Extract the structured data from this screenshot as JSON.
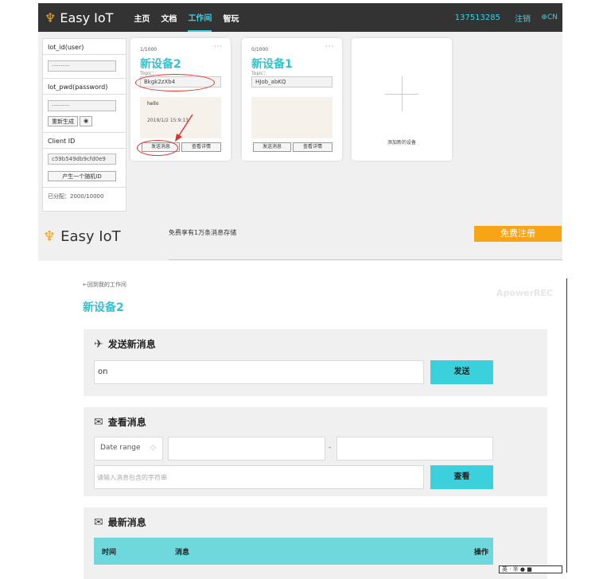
{
  "top": {
    "app_name": "Easy IoT",
    "nav": {
      "home": "主页",
      "docs": "文档",
      "workspace": "工作间",
      "smart": "智玩"
    },
    "phone": "137513285",
    "logout": "注销",
    "lang": "CN",
    "sidebar": {
      "iot_id_label": "Iot_id(user)",
      "iot_id_value": "··········",
      "iot_pwd_label": "Iot_pwd(password)",
      "iot_pwd_value": "··········",
      "regen_label": "重新生成",
      "client_id_label": "Client ID",
      "client_id_value": "c59b549db9cfd0e9",
      "gen_random_label": "产生一个随机ID",
      "allocated": "已分配：2000/10000"
    },
    "cards": [
      {
        "count": "1/1000",
        "name": "新设备2",
        "topic_label": "Topic：",
        "topic": "Bkgk2zXb4",
        "msg": "hello",
        "time": "2019/1/2 15:9:13",
        "send_label": "发送消息",
        "detail_label": "查看详情"
      },
      {
        "count": "0/1000",
        "name": "新设备1",
        "topic_label": "Topic：",
        "topic": "HJob_abKQ",
        "msg": "",
        "time": "",
        "send_label": "发送消息",
        "detail_label": "查看详情"
      }
    ],
    "add_device": "添加新的设备",
    "footer_text": "免费享有1万条消息存储",
    "register": "免费注册"
  },
  "detail": {
    "back": "←回到我的工作间",
    "watermark": "ApowerREC",
    "title": "新设备2",
    "send_section": {
      "title": "发送新消息",
      "input_value": "on",
      "button": "发送"
    },
    "view_section": {
      "title": "查看消息",
      "date_range": "Date range",
      "sep": "-",
      "search_placeholder": "请输入消息包含的字符串",
      "button": "查看"
    },
    "latest_section": {
      "title": "最新消息",
      "columns": [
        "时间",
        "消息",
        "操作"
      ]
    },
    "taskbar": "英 · 半 ● ■"
  },
  "colors": {
    "accent": "#3bbfca",
    "orange": "#f7a416",
    "dark": "#333333",
    "red": "#e0312d"
  }
}
